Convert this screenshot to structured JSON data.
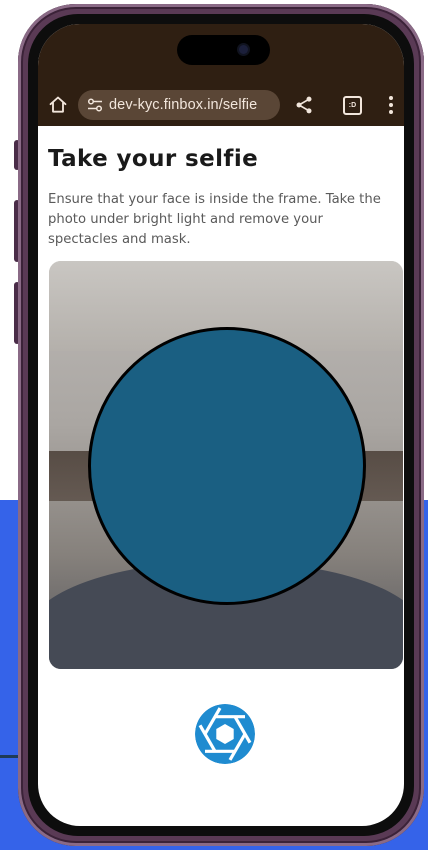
{
  "browser": {
    "url": "dev-kyc.finbox.in/selfie",
    "tab_icon_label": ":D"
  },
  "page": {
    "title": "Take your selfie",
    "description": "Ensure that your face is inside the frame. Take the photo under bright light and remove your spectacles and mask."
  },
  "colors": {
    "browser_chrome": "#2f1f12",
    "url_pill": "#5a4636",
    "face_mask": "#1a5f82",
    "shutter": "#1f8bd0",
    "background_accent": "#3563e9",
    "connector": "#1e3a56",
    "phone_frame": "#5a3a55"
  },
  "icons": {
    "home": "home-icon",
    "site_settings": "tune-icon",
    "share": "share-icon",
    "tabs": "tabs-icon",
    "menu": "more-vert-icon",
    "shutter": "camera-shutter-icon"
  }
}
